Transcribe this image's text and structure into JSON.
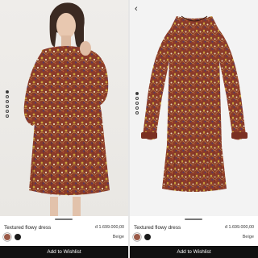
{
  "colors": {
    "button_bg": "#111111",
    "button_text": "#ffffff",
    "print_base": "#8a3b2a",
    "print_accents": [
      "#c9a43a",
      "#e8d9b8",
      "#5a3a60",
      "#b9542e"
    ]
  },
  "products": [
    {
      "name": "Textured flowy dress",
      "price": "đ 1.699.000,00",
      "color_label": "Beige",
      "swatches": [
        {
          "name": "print-swatch",
          "color": "#9a5a48",
          "selected": true
        },
        {
          "name": "black-swatch",
          "color": "#1a1a1a",
          "selected": false
        }
      ],
      "wishlist_label": "Add to Wishlist",
      "carousel": {
        "count": 6,
        "active_index": 0
      }
    },
    {
      "name": "Textured flowy dress",
      "price": "đ 1.699.000,00",
      "color_label": "Beige",
      "swatches": [
        {
          "name": "print-swatch",
          "color": "#9a5a48",
          "selected": true
        },
        {
          "name": "black-swatch",
          "color": "#1a1a1a",
          "selected": false
        }
      ],
      "wishlist_label": "Add to Wishlist",
      "back_icon": "chevron-left-icon",
      "carousel": {
        "count": 5,
        "active_index": 0
      }
    }
  ]
}
